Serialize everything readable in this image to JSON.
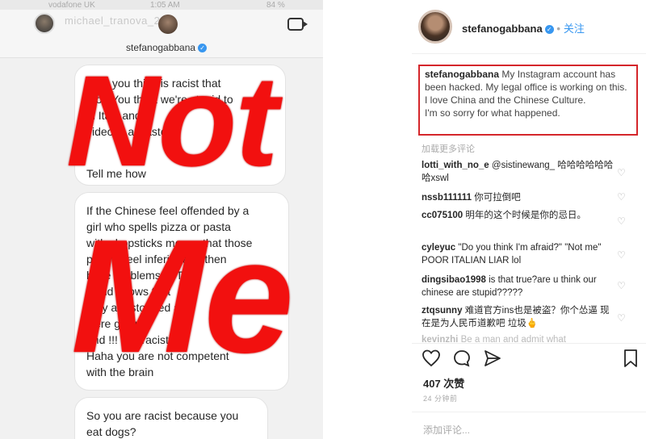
{
  "dm": {
    "status": {
      "carrier": "vodafone UK",
      "time": "1:05 AM",
      "battery": "84 %"
    },
    "top_username": "michael_tranova_280",
    "thread_username": "stefanogabbana",
    "messages": [
      {
        "line1": "Why you think is racist that",
        "line2": "too? You think we're stupid to",
        "line3": "in Italy and",
        "line4": "video is a waste",
        "tail": "Tell me how"
      },
      {
        "text": "If the Chinese feel offended by a\ngirl who spells pizza or pasta\nwith chopsticks means that those\npeople feel inferior and then\nhave problems !!! The\nworld knows that\nthey are stopped and\nwere given\nand !!! Is it racist?\nHaha you are not competent\nwith the brain"
      },
      {
        "text": "So you are racist because you\neat dogs?"
      }
    ],
    "overlay_text": {
      "line1": "Not",
      "line2": "Me"
    }
  },
  "post": {
    "username": "stefanogabbana",
    "follow_label": "关注",
    "caption": {
      "user": "stefanogabbana",
      "text": "My Instagram account has been hacked. My legal office is working on this.",
      "line2": "I love China and the Chinese Culture.",
      "line3": "I'm so sorry for what happened."
    },
    "load_more": "加载更多评论",
    "comments": [
      {
        "user": "lotti_with_no_e",
        "text": "@sistinewang_ 哈哈哈哈哈哈哈xswl"
      },
      {
        "user": "nssb111111",
        "text": "你可拉倒吧"
      },
      {
        "user": "cc075100",
        "text": "明年的这个时候是你的忌日。"
      },
      {
        "user": "cyleyuc",
        "text": "\"Do you think I'm afraid?\" \"Not me\" POOR ITALIAN LIAR lol"
      },
      {
        "user": "dingsibao1998",
        "text": "is that true?are u think our chinese are stupid?????"
      },
      {
        "user": "ztqsunny",
        "text": "难道官方ins也是被盗？你个怂逼 现在是为人民币道歉吧 垃圾🖕"
      },
      {
        "user": "kevinzhi",
        "text": "Be a man and admit what"
      }
    ],
    "likes": "407 次赞",
    "time_ago": "24 分钟前",
    "add_comment_placeholder": "添加评论..."
  },
  "colors": {
    "overlay_red": "#f2100f",
    "highlight_border": "#d5262b",
    "link_blue": "#3897f0"
  }
}
